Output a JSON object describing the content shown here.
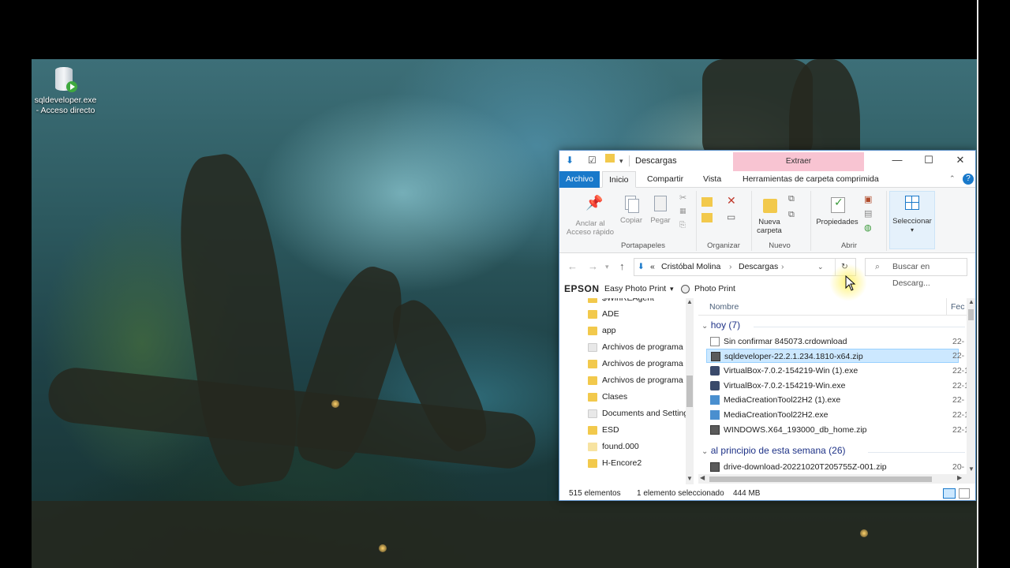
{
  "desktop": {
    "icon": {
      "label_line1": "sqldeveloper.exe",
      "label_line2": "- Acceso directo"
    }
  },
  "window": {
    "title": "Descargas",
    "contextual_tab": "Extraer",
    "tabs": [
      "Archivo",
      "Inicio",
      "Compartir",
      "Vista",
      "Herramientas de carpeta comprimida"
    ],
    "active_tab": "Inicio",
    "ribbon": {
      "anclar_line1": "Anclar al",
      "anclar_line2": "Acceso rápido",
      "copiar": "Copiar",
      "pegar": "Pegar",
      "portapapeles": "Portapapeles",
      "organizar": "Organizar",
      "nueva_line1": "Nueva",
      "nueva_line2": "carpeta",
      "nuevo": "Nuevo",
      "propiedades": "Propiedades",
      "abrir": "Abrir",
      "seleccionar": "Seleccionar"
    },
    "address": {
      "prefix": "«",
      "crumb1": "Cristóbal Molina",
      "crumb2": "Descargas"
    },
    "search_placeholder": "Buscar en Descarg...",
    "epson": {
      "brand": "EPSON",
      "app1": "Easy Photo Print",
      "app2": "Photo Print"
    },
    "nav_items": [
      "$WinREAgent",
      "ADE",
      "app",
      "Archivos de programa",
      "Archivos de programa",
      "Archivos de programa",
      "Clases",
      "Documents and Settings",
      "ESD",
      "found.000",
      "H-Encore2"
    ],
    "column_header": "Nombre",
    "column_date": "Fec",
    "groups": [
      {
        "label": "hoy (7)",
        "files": [
          {
            "name": "Sin confirmar 845073.crdownload",
            "date": "22-",
            "icon": "file-icon"
          },
          {
            "name": "sqldeveloper-22.2.1.234.1810-x64.zip",
            "date": "22-",
            "icon": "zip-icon"
          },
          {
            "name": "VirtualBox-7.0.2-154219-Win (1).exe",
            "date": "22-1",
            "icon": "virtualbox-icon"
          },
          {
            "name": "VirtualBox-7.0.2-154219-Win.exe",
            "date": "22-1",
            "icon": "virtualbox-icon"
          },
          {
            "name": "MediaCreationTool22H2 (1).exe",
            "date": "22-",
            "icon": "media-tool-icon"
          },
          {
            "name": "MediaCreationTool22H2.exe",
            "date": "22-1",
            "icon": "media-tool-icon"
          },
          {
            "name": "WINDOWS.X64_193000_db_home.zip",
            "date": "22-1",
            "icon": "zip-icon"
          }
        ]
      },
      {
        "label": "al principio de esta semana (26)",
        "files": [
          {
            "name": "drive-download-20221020T205755Z-001.zip",
            "date": "20-",
            "icon": "zip-icon"
          }
        ]
      }
    ],
    "status": {
      "count": "515 elementos",
      "selected": "1 elemento seleccionado",
      "size": "444 MB"
    }
  },
  "colors": {
    "accent": "#1979ca",
    "selection": "#cce8ff",
    "extraer_tab": "#f8c4d2",
    "group_text": "#1e3287"
  }
}
